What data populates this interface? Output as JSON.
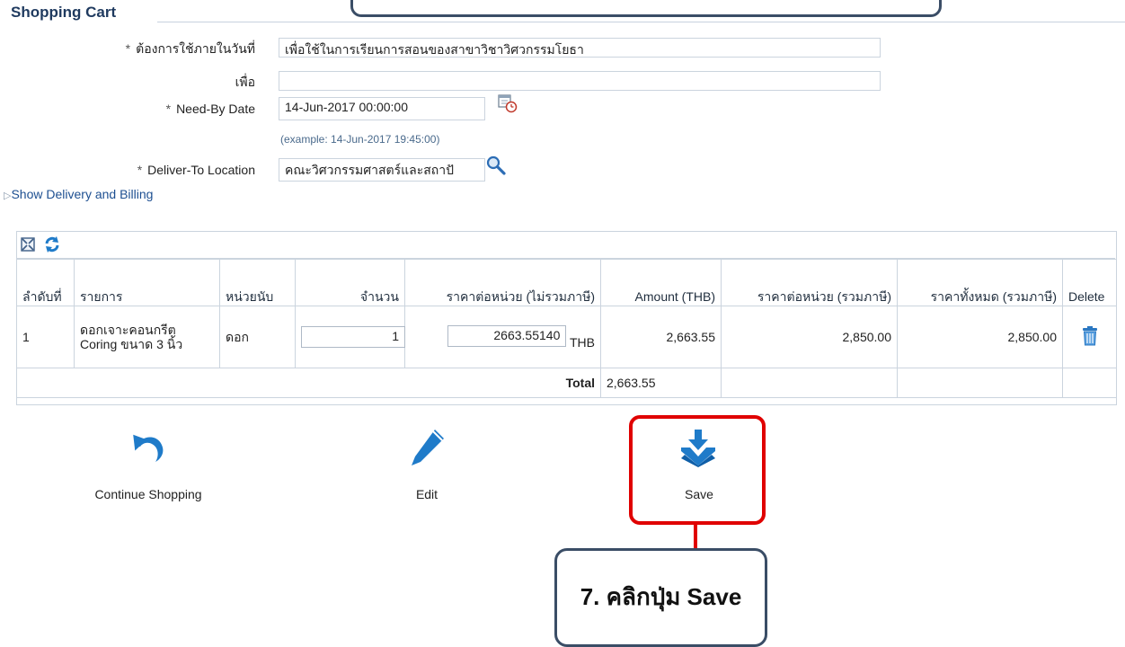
{
  "page": {
    "title": "Shopping Cart"
  },
  "form": {
    "justification": {
      "label": "ต้องการใช้ภายในวันที่",
      "value": "เพื่อใช้ในการเรียนการสอนของสาขาวิชาวิศวกรรมโยธา",
      "required": "*"
    },
    "for": {
      "label": "เพื่อ",
      "value": ""
    },
    "need_by_date": {
      "label": "Need-By Date",
      "value": "14-Jun-2017 00:00:00",
      "hint": "(example: 14-Jun-2017 19:45:00)",
      "required": "*"
    },
    "deliver_to": {
      "label": "Deliver-To Location",
      "value": "คณะวิศวกรรมศาสตร์และสถาปั",
      "required": "*"
    },
    "show_delivery_link": "Show Delivery and Billing"
  },
  "table": {
    "headers": {
      "seq": "ลำดับที่",
      "item": "รายการ",
      "unit": "หน่วยนับ",
      "qty": "จำนวน",
      "unit_price_ex": "ราคาต่อหน่วย (ไม่รวมภาษี)",
      "amount": "Amount (THB)",
      "unit_price_inc": "ราคาต่อหน่วย (รวมภาษี)",
      "total_inc": "ราคาทั้งหมด (รวมภาษี)",
      "delete": "Delete"
    },
    "rows": [
      {
        "seq": "1",
        "item": "ดอกเจาะคอนกรีต Coring ขนาด 3 นิ้ว",
        "unit": "ดอก",
        "qty": "1",
        "unit_price_ex": "2663.55140",
        "currency": "THB",
        "amount": "2,663.55",
        "unit_price_inc": "2,850.00",
        "total_inc": "2,850.00"
      }
    ],
    "total_label": "Total",
    "total_amount": "2,663.55"
  },
  "actions": {
    "continue": "Continue Shopping",
    "edit": "Edit",
    "save": "Save"
  },
  "callout": {
    "text": "7. คลิกปุ่ม Save"
  },
  "colors": {
    "icon_blue": "#1f7bc9",
    "highlight_red": "#e00000",
    "callout_border": "#3a4d66"
  }
}
